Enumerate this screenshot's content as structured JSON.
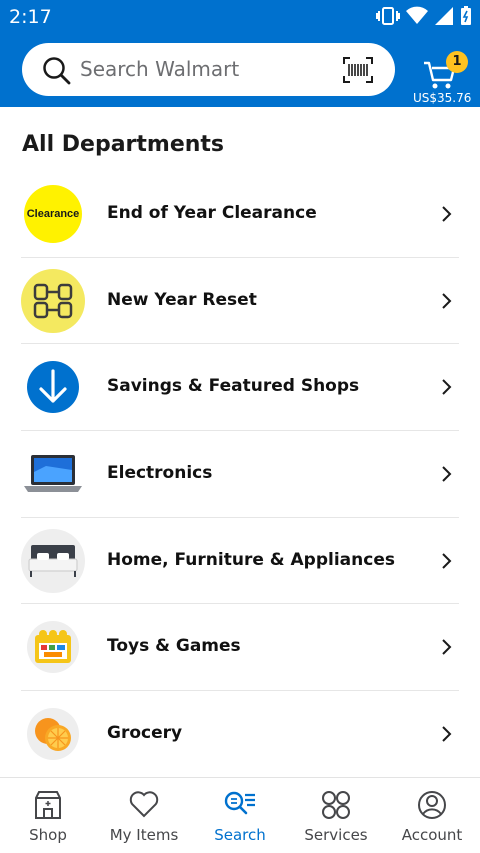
{
  "status_bar": {
    "time": "2:17"
  },
  "search": {
    "placeholder": "Search Walmart"
  },
  "cart": {
    "badge_count": "1",
    "total": "US$35.76"
  },
  "page": {
    "title": "All Departments"
  },
  "departments": [
    {
      "label": "End of Year Clearance",
      "thumb_text": "Clearance",
      "icon": "clearance-badge-icon"
    },
    {
      "label": "New Year Reset",
      "icon": "dumbbell-icon"
    },
    {
      "label": "Savings & Featured Shops",
      "icon": "arrow-down-circle-icon"
    },
    {
      "label": "Electronics",
      "icon": "laptop-icon"
    },
    {
      "label": "Home, Furniture & Appliances",
      "icon": "bed-icon"
    },
    {
      "label": "Toys & Games",
      "icon": "toy-blocks-icon"
    },
    {
      "label": "Grocery",
      "icon": "orange-icon"
    }
  ],
  "bottom_nav": [
    {
      "label": "Shop",
      "icon": "store-icon"
    },
    {
      "label": "My Items",
      "icon": "heart-icon"
    },
    {
      "label": "Search",
      "icon": "search-list-icon",
      "active": true
    },
    {
      "label": "Services",
      "icon": "grid-circles-icon"
    },
    {
      "label": "Account",
      "icon": "account-icon"
    }
  ],
  "colors": {
    "brand_blue": "#0071ce",
    "spark_yellow": "#ffc220"
  }
}
